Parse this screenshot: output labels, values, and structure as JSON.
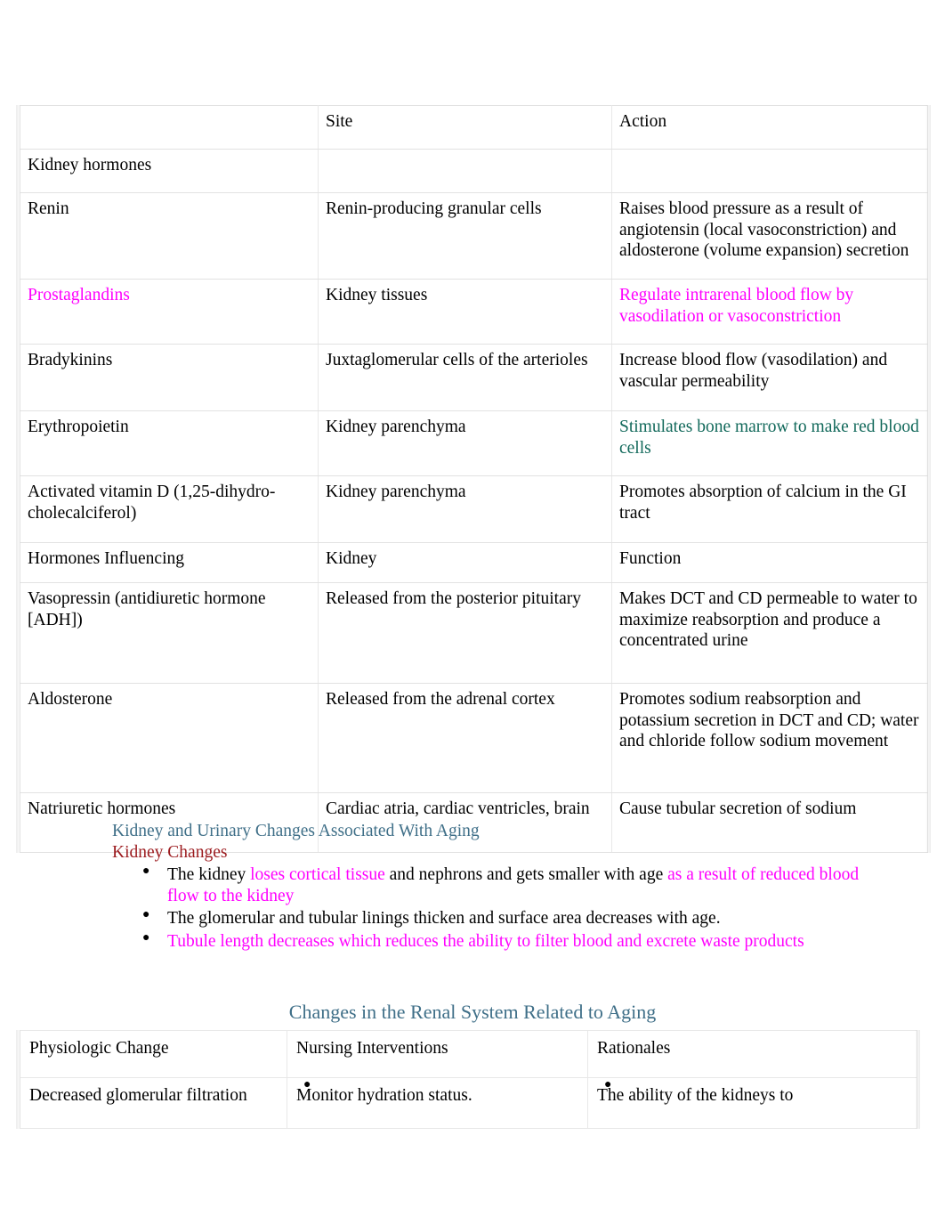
{
  "colors": {
    "magenta": "#ff00ff",
    "teal_text": "#12695b",
    "heading_blue": "#3f6f88",
    "heading_red": "#9c1b1f",
    "border": "#e8e8e8"
  },
  "hormone_table": {
    "headers": {
      "col1": "",
      "col2": "Site",
      "col3": "Action"
    },
    "rows": [
      {
        "name": "Kidney hormones",
        "site": "",
        "action": ""
      },
      {
        "name": "Renin",
        "site": "Renin-producing granular cells",
        "action": "Raises blood pressure as a result of angiotensin (local vasoconstriction) and aldosterone (volume expansion) secretion"
      },
      {
        "name": "Prostaglandins",
        "site": "Kidney tissues",
        "action": "Regulate intrarenal blood flow by vasodilation or vasoconstriction"
      },
      {
        "name": "Bradykinins",
        "site": "Juxtaglomerular cells of the arterioles",
        "action": "Increase blood flow (vasodilation) and vascular permeability"
      },
      {
        "name": "Erythropoietin",
        "site": "Kidney parenchyma",
        "action": "Stimulates bone marrow to make red blood cells"
      },
      {
        "name": "Activated vitamin D (1,25-dihydro-cholecalciferol)",
        "site": "Kidney parenchyma",
        "action": "Promotes absorption of calcium in the GI tract"
      },
      {
        "name": "Hormones Influencing",
        "site": "Kidney",
        "action": "Function"
      },
      {
        "name": "Vasopressin (antidiuretic hormone [ADH])",
        "site": "Released from the posterior pituitary",
        "action": "Makes DCT and CD permeable to water to maximize reabsorption and produce a concentrated urine"
      },
      {
        "name": "Aldosterone",
        "site": "Released from the adrenal cortex",
        "action": "Promotes sodium reabsorption and potassium secretion in DCT and CD; water and chloride follow sodium movement"
      },
      {
        "name": "Natriuretic hormones",
        "site": "Cardiac atria, cardiac ventricles, brain",
        "action": "Cause tubular secretion of sodium"
      }
    ]
  },
  "aging_section": {
    "heading": "Kidney and Urinary Changes Associated With Aging",
    "subheading": "Kidney Changes",
    "bullets": [
      {
        "part1": "The kidney ",
        "part2": "loses cortical tissue",
        "part3": " and nephrons and gets smaller with age ",
        "part4": "as a result of reduced blood flow to the kidney"
      },
      {
        "part1": "The glomerular and tubular linings thicken and surface area decreases with age.",
        "part2": "",
        "part3": "",
        "part4": ""
      },
      {
        "part1": "",
        "part2": "",
        "part3": "",
        "part4": "Tubule length decreases which reduces the ability to filter blood and excrete waste products"
      }
    ]
  },
  "renal_table": {
    "title": "Changes in the Renal System Related to Aging",
    "headers": {
      "col1": "Physiologic Change",
      "col2": "Nursing Interventions",
      "col3": "Rationales"
    },
    "rows": [
      {
        "change": "Decreased glomerular filtration",
        "intervention": "Monitor hydration status.",
        "rationale": "The ability of the kidneys to"
      }
    ]
  }
}
